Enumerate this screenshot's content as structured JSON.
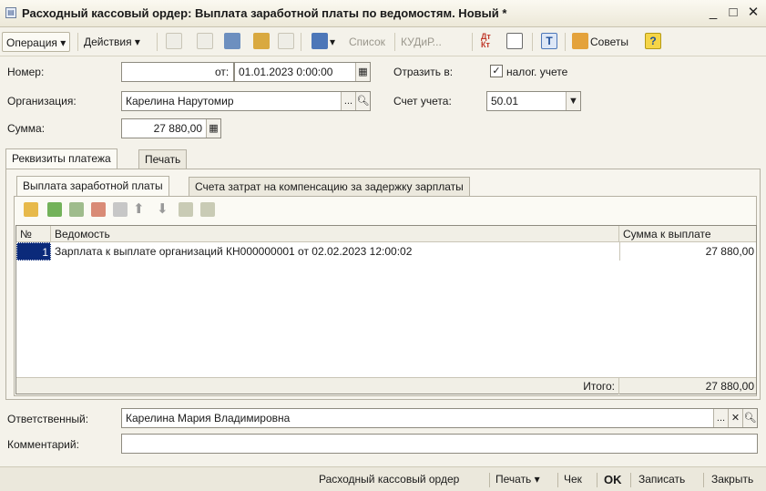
{
  "window": {
    "title": "Расходный кассовый ордер: Выплата заработной платы по ведомостям. Новый *",
    "minimize": "_",
    "maximize": "□",
    "close": "✕"
  },
  "toolbar": {
    "operation": "Операция ▾",
    "actions": "Действия ▾",
    "list": "Список",
    "kud": "КУДиР...",
    "tips": "Советы",
    "help": "?"
  },
  "form": {
    "number_label": "Номер:",
    "number_value": "",
    "date_label": "от:",
    "date_value": "01.01.2023  0:00:00",
    "reflect_label": "Отразить в:",
    "tax_checkbox_label": "налог. учете",
    "tax_checked": "✓",
    "org_label": "Организация:",
    "org_value": "Карелина Нарутомир",
    "account_label": "Счет учета:",
    "account_value": "50.01",
    "sum_label": "Сумма:",
    "sum_value": "27 880,00"
  },
  "tabs_outer": [
    "Реквизиты платежа",
    "Печать"
  ],
  "tabs_inner": [
    "Выплата заработной платы",
    "Счета затрат на компенсацию за задержку зарплаты"
  ],
  "table": {
    "headers": [
      "№",
      "Ведомость",
      "Сумма к выплате"
    ],
    "rows": [
      {
        "n": "1",
        "statement": "Зарплата к выплате организаций КН000000001 от 02.02.2023 12:00:02",
        "amount": "27 880,00"
      }
    ],
    "total_label": "Итого:",
    "total_value": "27 880,00"
  },
  "footer": {
    "responsible_label": "Ответственный:",
    "responsible_value": "Карелина Мария Владимировна",
    "comment_label": "Комментарий:",
    "comment_value": ""
  },
  "statusbar": {
    "rko": "Расходный кассовый ордер",
    "print": "Печать ▾",
    "check": "Чек",
    "ok": "OK",
    "save": "Записать",
    "close": "Закрыть"
  }
}
